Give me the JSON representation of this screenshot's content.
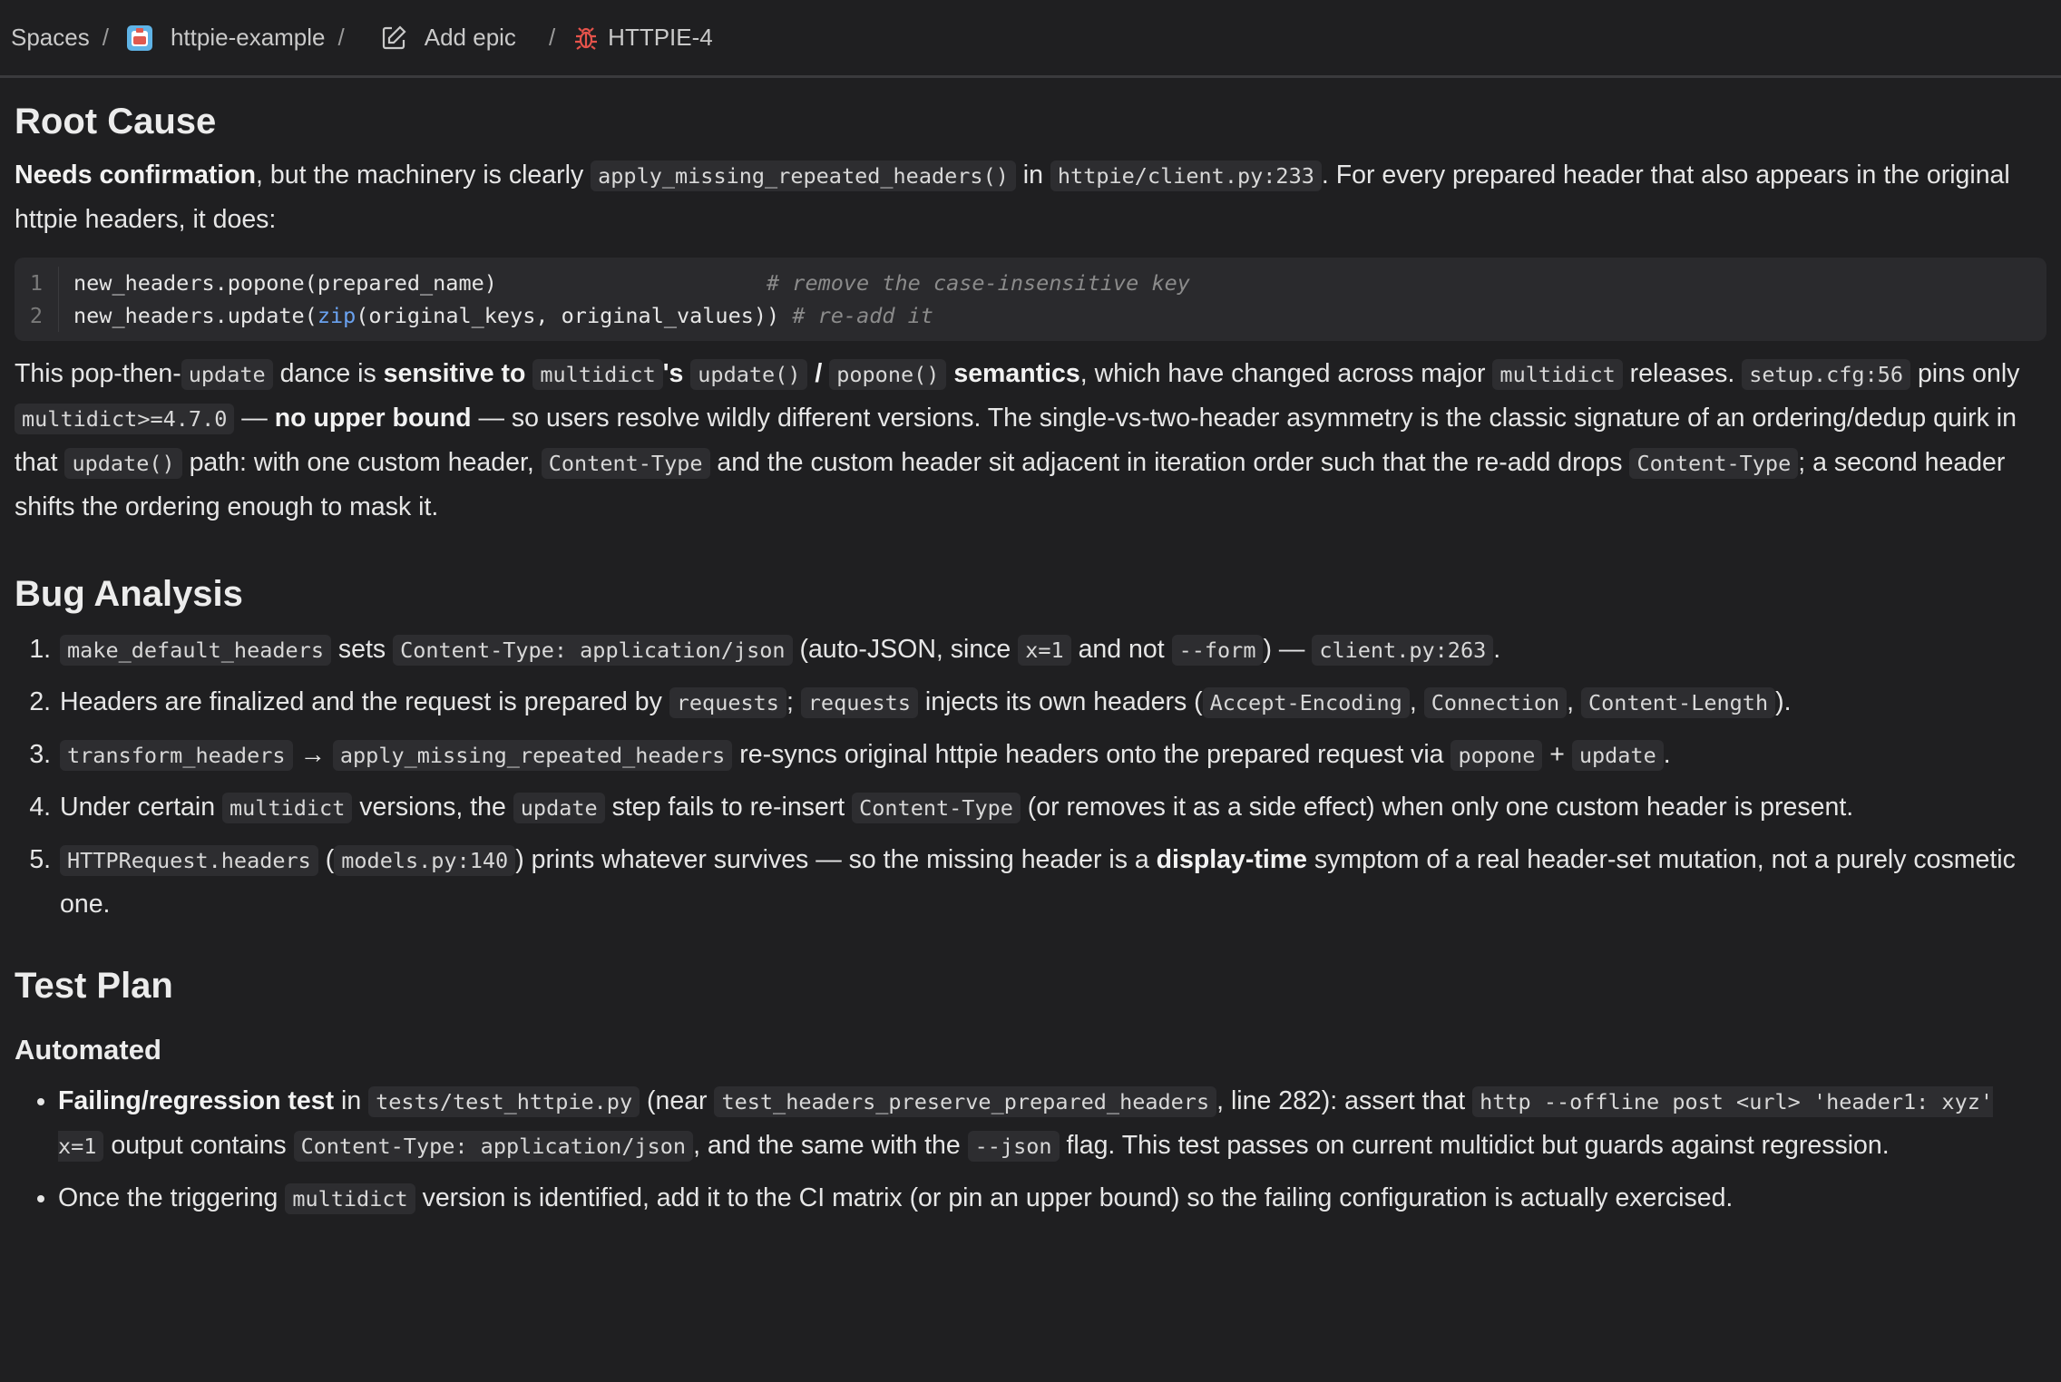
{
  "breadcrumb": {
    "spaces": "Spaces",
    "project": "httpie-example",
    "epic": "Add epic",
    "issue": "HTTPIE-4",
    "separator": "/"
  },
  "root_cause": {
    "heading": "Root Cause",
    "p1": {
      "bold": "Needs confirmation",
      "t1": ", but the machinery is clearly ",
      "c1": "apply_missing_repeated_headers()",
      "t2": " in ",
      "c2": "httpie/client.py:233",
      "t3": ". For every prepared header that also appears in the original httpie headers, it does:"
    },
    "code": {
      "line1_num": "1",
      "line1_code": "new_headers.popone(prepared_name)",
      "line1_pad": "                    ",
      "line1_comment": "# remove the case-insensitive key",
      "line2_num": "2",
      "line2_a": "new_headers.update(",
      "line2_fn": "zip",
      "line2_b": "(original_keys, original_values)) ",
      "line2_comment": "# re-add it"
    },
    "p2": {
      "t1": "This pop-then-",
      "c1": "update",
      "t2": " dance is ",
      "b1": "sensitive to ",
      "c2": "multidict",
      "b2": "'s ",
      "c3": "update()",
      "b3": " / ",
      "c4": "popone()",
      "b4": " semantics",
      "t3": ", which have changed across major ",
      "c5": "multidict",
      "t4": " releases. ",
      "c6": "setup.cfg:56",
      "t5": " pins only ",
      "c7": "multidict>=4.7.0",
      "t6": " — ",
      "b5": "no upper bound",
      "t7": " — so users resolve wildly different versions. The single-vs-two-header asymmetry is the classic signature of an ordering/dedup quirk in that ",
      "c8": "update()",
      "t8": " path: with one custom header, ",
      "c9": "Content-Type",
      "t9": " and the custom header sit adjacent in iteration order such that the re-add drops ",
      "c10": "Content-Type",
      "t10": "; a second header shifts the ordering enough to mask it."
    }
  },
  "bug_analysis": {
    "heading": "Bug Analysis",
    "i1": {
      "c1": "make_default_headers",
      "t1": " sets ",
      "c2": "Content-Type: application/json",
      "t2": " (auto-JSON, since ",
      "c3": "x=1",
      "t3": " and not ",
      "c4": "--form",
      "t4": ") — ",
      "c5": "client.py:263",
      "t5": "."
    },
    "i2": {
      "t1": "Headers are finalized and the request is prepared by ",
      "c1": "requests",
      "t2": "; ",
      "c2": "requests",
      "t3": " injects its own headers (",
      "c3": "Accept-Encoding",
      "t4": ", ",
      "c4": "Connection",
      "t5": ", ",
      "c5": "Content-Length",
      "t6": ")."
    },
    "i3": {
      "c1": "transform_headers",
      "t1": " → ",
      "c2": "apply_missing_repeated_headers",
      "t2": " re-syncs original httpie headers onto the prepared request via ",
      "c3": "popone",
      "t3": " + ",
      "c4": "update",
      "t4": "."
    },
    "i4": {
      "t1": "Under certain ",
      "c1": "multidict",
      "t2": " versions, the ",
      "c2": "update",
      "t3": " step fails to re-insert ",
      "c3": "Content-Type",
      "t4": " (or removes it as a side effect) when only one custom header is present."
    },
    "i5": {
      "c1": "HTTPRequest.headers",
      "t1": " (",
      "c2": "models.py:140",
      "t2": ") prints whatever survives — so the missing header is a ",
      "b1": "display-time",
      "t3": " symptom of a real header-set mutation, not a purely cosmetic one."
    }
  },
  "test_plan": {
    "heading": "Test Plan",
    "subheading": "Automated",
    "b1": {
      "b1": "Failing/regression test",
      "t1": " in ",
      "c1": "tests/test_httpie.py",
      "t2": " (near ",
      "c2": "test_headers_preserve_prepared_headers",
      "t3": ", line 282): assert that ",
      "c3": "http --offline post <url> 'header1: xyz' x=1",
      "t4": " output contains ",
      "c4": "Content-Type: application/json",
      "t5": ", and the same with the ",
      "c5": "--json",
      "t6": " flag. This test passes on current multidict but guards against regression."
    },
    "b2": {
      "t1": "Once the triggering ",
      "c1": "multidict",
      "t2": " version is identified, add it to the CI matrix (or pin an upper bound) so the failing configuration is actually exercised."
    }
  }
}
